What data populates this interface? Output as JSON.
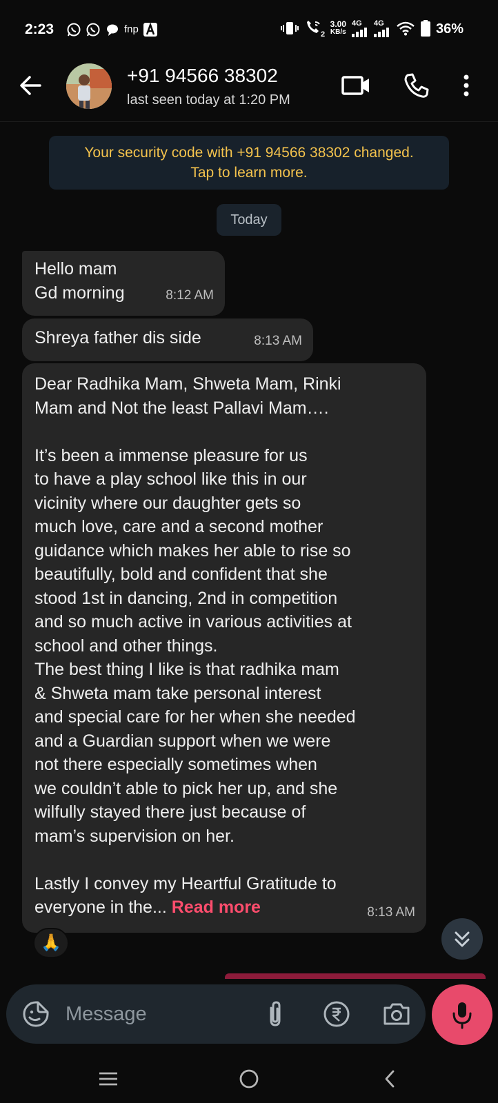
{
  "status_bar": {
    "time": "2:23",
    "carrier_label": "fnp",
    "net_speed": "3.00",
    "net_speed_unit": "KB/s",
    "sim1_type": "4G",
    "sim2_type": "4G",
    "battery": "36%"
  },
  "header": {
    "contact_name": "+91 94566 38302",
    "last_seen": "last seen today at 1:20 PM"
  },
  "notice": {
    "security_text": "Your security code with +91 94566 38302 changed.\nTap to learn more."
  },
  "date_chip": "Today",
  "messages": [
    {
      "text": "Hello mam\nGd morning",
      "time": "8:12 AM"
    },
    {
      "text": "Shreya father dis side",
      "time": "8:13 AM"
    },
    {
      "text": "Dear Radhika Mam, Shweta Mam, Rinki\nMam and Not the least Pallavi Mam….\n\nIt’s been a immense pleasure for us\nto have a play school like this in our\nvicinity where our daughter gets so\nmuch love, care and a second mother\nguidance which makes her able to rise so\nbeautifully, bold and confident that she\nstood 1st in dancing, 2nd in competition\nand so much active in various activities at\nschool and other things.\nThe best thing I like is that radhika mam\n& Shweta mam take personal interest\nand special care for her when she needed\nand a Guardian support when we were\nnot there especially sometimes when\nwe couldn’t able to pick her up, and she\nwilfully stayed there just because of\nmam’s supervision on her.\n\nLastly I  convey  my Heartful Gratitude to\neveryone in the... ",
      "read_more": "Read more",
      "time": "8:13 AM"
    }
  ],
  "reaction": "🙏",
  "composer": {
    "placeholder": "Message"
  },
  "colors": {
    "accent_read_more": "#ff4d6d",
    "mic_button": "#e84a6b",
    "security_notice_text": "#f4c34d",
    "bubble_incoming": "#262626"
  },
  "icons": [
    "back-arrow-icon",
    "video-call-icon",
    "voice-call-icon",
    "more-options-icon",
    "emoji-sticker-icon",
    "attach-icon",
    "rupee-payment-icon",
    "camera-icon",
    "mic-icon",
    "scroll-down-icon",
    "nav-menu-icon",
    "nav-home-icon",
    "nav-back-icon"
  ]
}
